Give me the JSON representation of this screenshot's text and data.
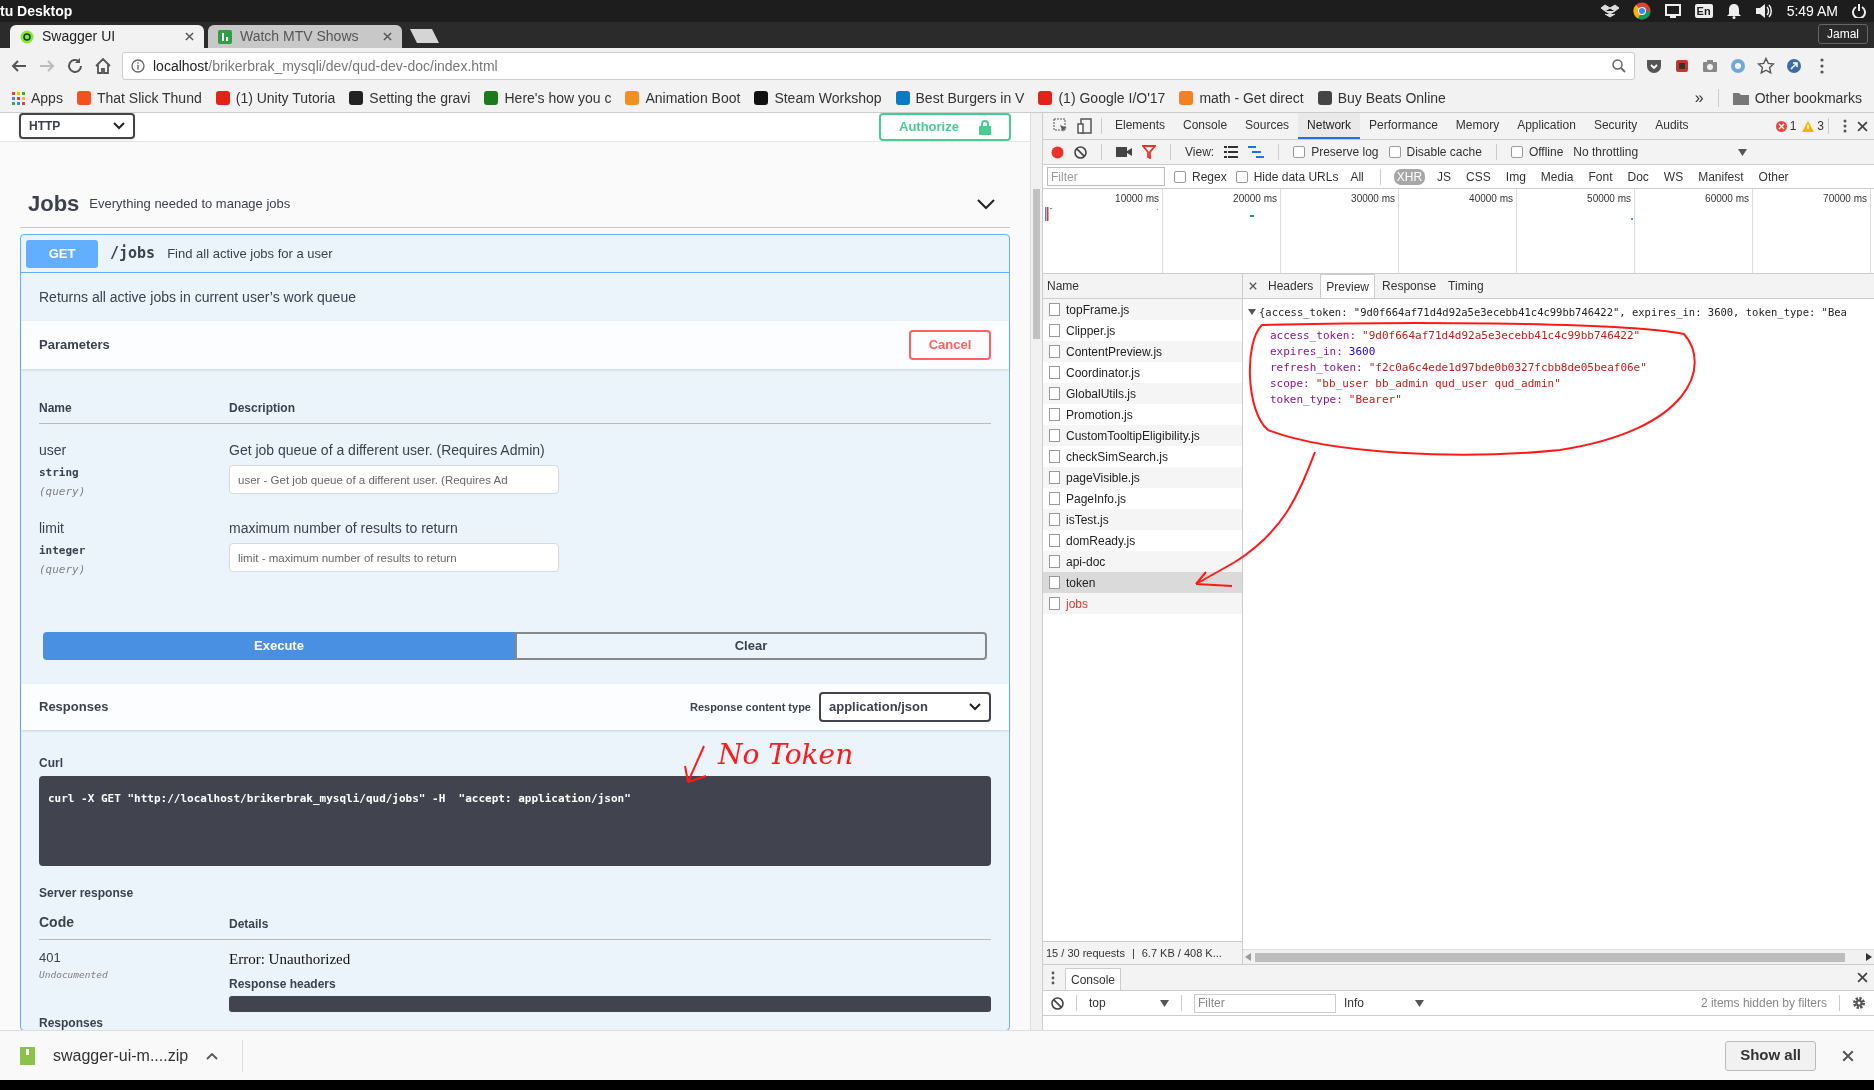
{
  "os_bar": {
    "title": "tu Desktop",
    "keyboard": "En",
    "time": "5:49 AM"
  },
  "browser": {
    "user": "Jamal",
    "tabs": [
      {
        "label": "Swagger UI",
        "selected": true
      },
      {
        "label": "Watch MTV Shows",
        "selected": false
      }
    ],
    "url_host": "localhost",
    "url_path": "/brikerbrak_mysqli/dev/qud-dev-doc/index.html",
    "apps": "Apps",
    "bookmarks": [
      {
        "label": "That Slick Thund",
        "color": "#f4511e"
      },
      {
        "label": "(1) Unity Tutoria",
        "color": "#e62117"
      },
      {
        "label": "Setting the gravi",
        "color": "#222222"
      },
      {
        "label": "Here's how you c",
        "color": "#1b7a1b"
      },
      {
        "label": "Animation Boot",
        "color": "#f09020"
      },
      {
        "label": "Steam Workshop",
        "color": "#111111"
      },
      {
        "label": "Best Burgers in V",
        "color": "#0a7ac2"
      },
      {
        "label": "(1) Google I/O'17",
        "color": "#e62117"
      },
      {
        "label": "math - Get direct",
        "color": "#f48024"
      },
      {
        "label": "Buy Beats Online",
        "color": "#444444"
      }
    ],
    "overflow": "»",
    "other_bookmarks": "Other bookmarks"
  },
  "swagger": {
    "scheme": "HTTP",
    "authorize": "Authorize",
    "tag": {
      "name": "Jobs",
      "description": "Everything needed to manage jobs",
      "expanded": true
    },
    "operation": {
      "method": "GET",
      "path": "/jobs",
      "summary": "Find all active jobs for a user",
      "description": "Returns all active jobs in current user’s work queue"
    },
    "parameters_title": "Parameters",
    "cancel": "Cancel",
    "columns": [
      "Name",
      "Description"
    ],
    "parameters": [
      {
        "name": "user",
        "type": "string",
        "in": "(query)",
        "description": "Get job queue of a different user. (Requires Admin)",
        "placeholder": "user - Get job queue of a different user. (Requires Ad"
      },
      {
        "name": "limit",
        "type": "integer",
        "in": "(query)",
        "description": "maximum number of results to return",
        "placeholder": "limit - maximum number of results to return"
      }
    ],
    "execute": "Execute",
    "clear": "Clear",
    "responses_title": "Responses",
    "content_type_label": "Response content type",
    "content_type": "application/json",
    "curl_label": "Curl",
    "curl": "curl -X GET \"http://localhost/brikerbrak_mysqli/qud/jobs\" -H  \"accept: application/json\"",
    "server_response_title": "Server response",
    "response_columns": [
      "Code",
      "Details"
    ],
    "response": {
      "code": "401",
      "note": "Undocumented",
      "details": "Error: Unauthorized",
      "headers_label": "Response headers"
    },
    "next_section": "Responses"
  },
  "devtools": {
    "panels": [
      {
        "label": "Elements",
        "selected": false
      },
      {
        "label": "Console",
        "selected": false
      },
      {
        "label": "Sources",
        "selected": false
      },
      {
        "label": "Network",
        "selected": true
      },
      {
        "label": "Performance",
        "selected": false
      },
      {
        "label": "Memory",
        "selected": false
      },
      {
        "label": "Application",
        "selected": false
      },
      {
        "label": "Security",
        "selected": false
      },
      {
        "label": "Audits",
        "selected": false
      }
    ],
    "errors": "1",
    "warnings": "3",
    "recording": true,
    "filter_active": true,
    "view_label": "View:",
    "options": [
      {
        "label": "Preserve log",
        "checked": false
      },
      {
        "label": "Disable cache",
        "checked": false
      },
      {
        "label": "Offline",
        "checked": false
      }
    ],
    "throttling": "No throttling",
    "filter_placeholder": "Filter",
    "filter_options": [
      {
        "label": "Regex",
        "checked": false
      },
      {
        "label": "Hide data URLs",
        "checked": false
      }
    ],
    "types": [
      {
        "label": "All",
        "selected": false
      },
      {
        "label": "XHR",
        "selected": true
      },
      {
        "label": "JS",
        "selected": false
      },
      {
        "label": "CSS",
        "selected": false
      },
      {
        "label": "Img",
        "selected": false
      },
      {
        "label": "Media",
        "selected": false
      },
      {
        "label": "Font",
        "selected": false
      },
      {
        "label": "Doc",
        "selected": false
      },
      {
        "label": "WS",
        "selected": false
      },
      {
        "label": "Manifest",
        "selected": false
      },
      {
        "label": "Other",
        "selected": false
      }
    ],
    "timeline_ticks": [
      "10000 ms",
      "20000 ms",
      "30000 ms",
      "40000 ms",
      "50000 ms",
      "60000 ms",
      "70000 ms"
    ],
    "name_column": "Name",
    "requests": [
      {
        "name": "topFrame.js",
        "selected": false,
        "failed": false
      },
      {
        "name": "Clipper.js",
        "selected": false,
        "failed": false
      },
      {
        "name": "ContentPreview.js",
        "selected": false,
        "failed": false
      },
      {
        "name": "Coordinator.js",
        "selected": false,
        "failed": false
      },
      {
        "name": "GlobalUtils.js",
        "selected": false,
        "failed": false
      },
      {
        "name": "Promotion.js",
        "selected": false,
        "failed": false
      },
      {
        "name": "CustomTooltipEligibility.js",
        "selected": false,
        "failed": false
      },
      {
        "name": "checkSimSearch.js",
        "selected": false,
        "failed": false
      },
      {
        "name": "pageVisible.js",
        "selected": false,
        "failed": false
      },
      {
        "name": "PageInfo.js",
        "selected": false,
        "failed": false
      },
      {
        "name": "isTest.js",
        "selected": false,
        "failed": false
      },
      {
        "name": "domReady.js",
        "selected": false,
        "failed": false
      },
      {
        "name": "api-doc",
        "selected": false,
        "failed": false
      },
      {
        "name": "token",
        "selected": true,
        "failed": false
      },
      {
        "name": "jobs",
        "selected": false,
        "failed": true
      }
    ],
    "detail_tabs": [
      {
        "label": "Headers",
        "selected": false
      },
      {
        "label": "Preview",
        "selected": true
      },
      {
        "label": "Response",
        "selected": false
      },
      {
        "label": "Timing",
        "selected": false
      }
    ],
    "preview": {
      "expanded": true,
      "summary": "{access_token: \"9d0f664af71d4d92a5e3ecebb41c4c99bb746422\", expires_in: 3600, token_type: \"Bea",
      "properties": [
        {
          "key": "access_token:",
          "value": "\"9d0f664af71d4d92a5e3ecebb41c4c99bb746422\"",
          "kind": "string"
        },
        {
          "key": "expires_in:",
          "value": "3600",
          "kind": "number"
        },
        {
          "key": "refresh_token:",
          "value": "\"f2c0a6c4ede1d97bde0b0327fcbb8de05beaf06e\"",
          "kind": "string"
        },
        {
          "key": "scope:",
          "value": "\"bb_user bb_admin qud_user qud_admin\"",
          "kind": "string"
        },
        {
          "key": "token_type:",
          "value": "\"Bearer\"",
          "kind": "string"
        }
      ]
    },
    "summary": {
      "requests": "15 / 30 requests",
      "separator": "|",
      "transferred": "6.7 KB / 408 K..."
    },
    "console": {
      "tab": "Console",
      "context": "top",
      "filter_placeholder": "Filter",
      "level": "Info",
      "hidden": "2 items hidden by filters"
    }
  },
  "annotation": {
    "note": "No Token"
  },
  "downloads": {
    "file": "swagger-ui-m....zip",
    "show_all": "Show all"
  }
}
